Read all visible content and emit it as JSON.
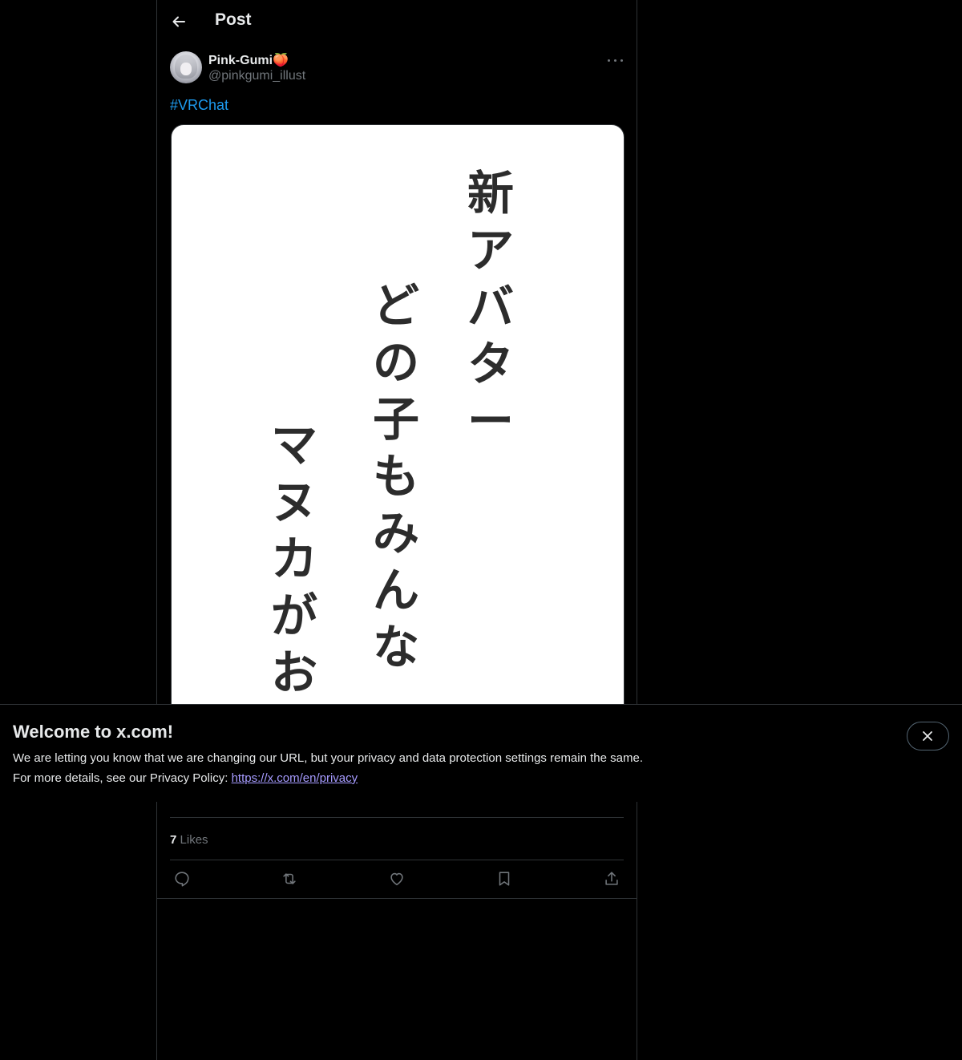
{
  "header": {
    "title": "Post"
  },
  "author": {
    "name": "Pink-Gumi🍑",
    "handle": "@pinkgumi_illust"
  },
  "post": {
    "hashtag": "#VRChat"
  },
  "image": {
    "columns": [
      [
        "新",
        "ア",
        "バ",
        "タ",
        "ー"
      ],
      [
        "ど",
        "の",
        "子",
        "も",
        "み",
        "ん",
        "な"
      ],
      [
        "マ",
        "ヌ",
        "カ",
        "が",
        "お"
      ]
    ]
  },
  "stats": {
    "likes_count": "7",
    "likes_label": "Likes"
  },
  "actions": {
    "icons": [
      "reply-icon",
      "repost-icon",
      "like-icon",
      "bookmark-icon",
      "share-icon"
    ]
  },
  "banner": {
    "title": "Welcome to x.com!",
    "line1": "We are letting you know that we are changing our URL, but your privacy and data protection settings remain the same.",
    "line2_prefix": "For more details, see our Privacy Policy: ",
    "link": "https://x.com/en/privacy"
  },
  "colors": {
    "background": "#000000",
    "accent": "#1d9bf0",
    "muted": "#71767b",
    "link": "#a69bff"
  }
}
